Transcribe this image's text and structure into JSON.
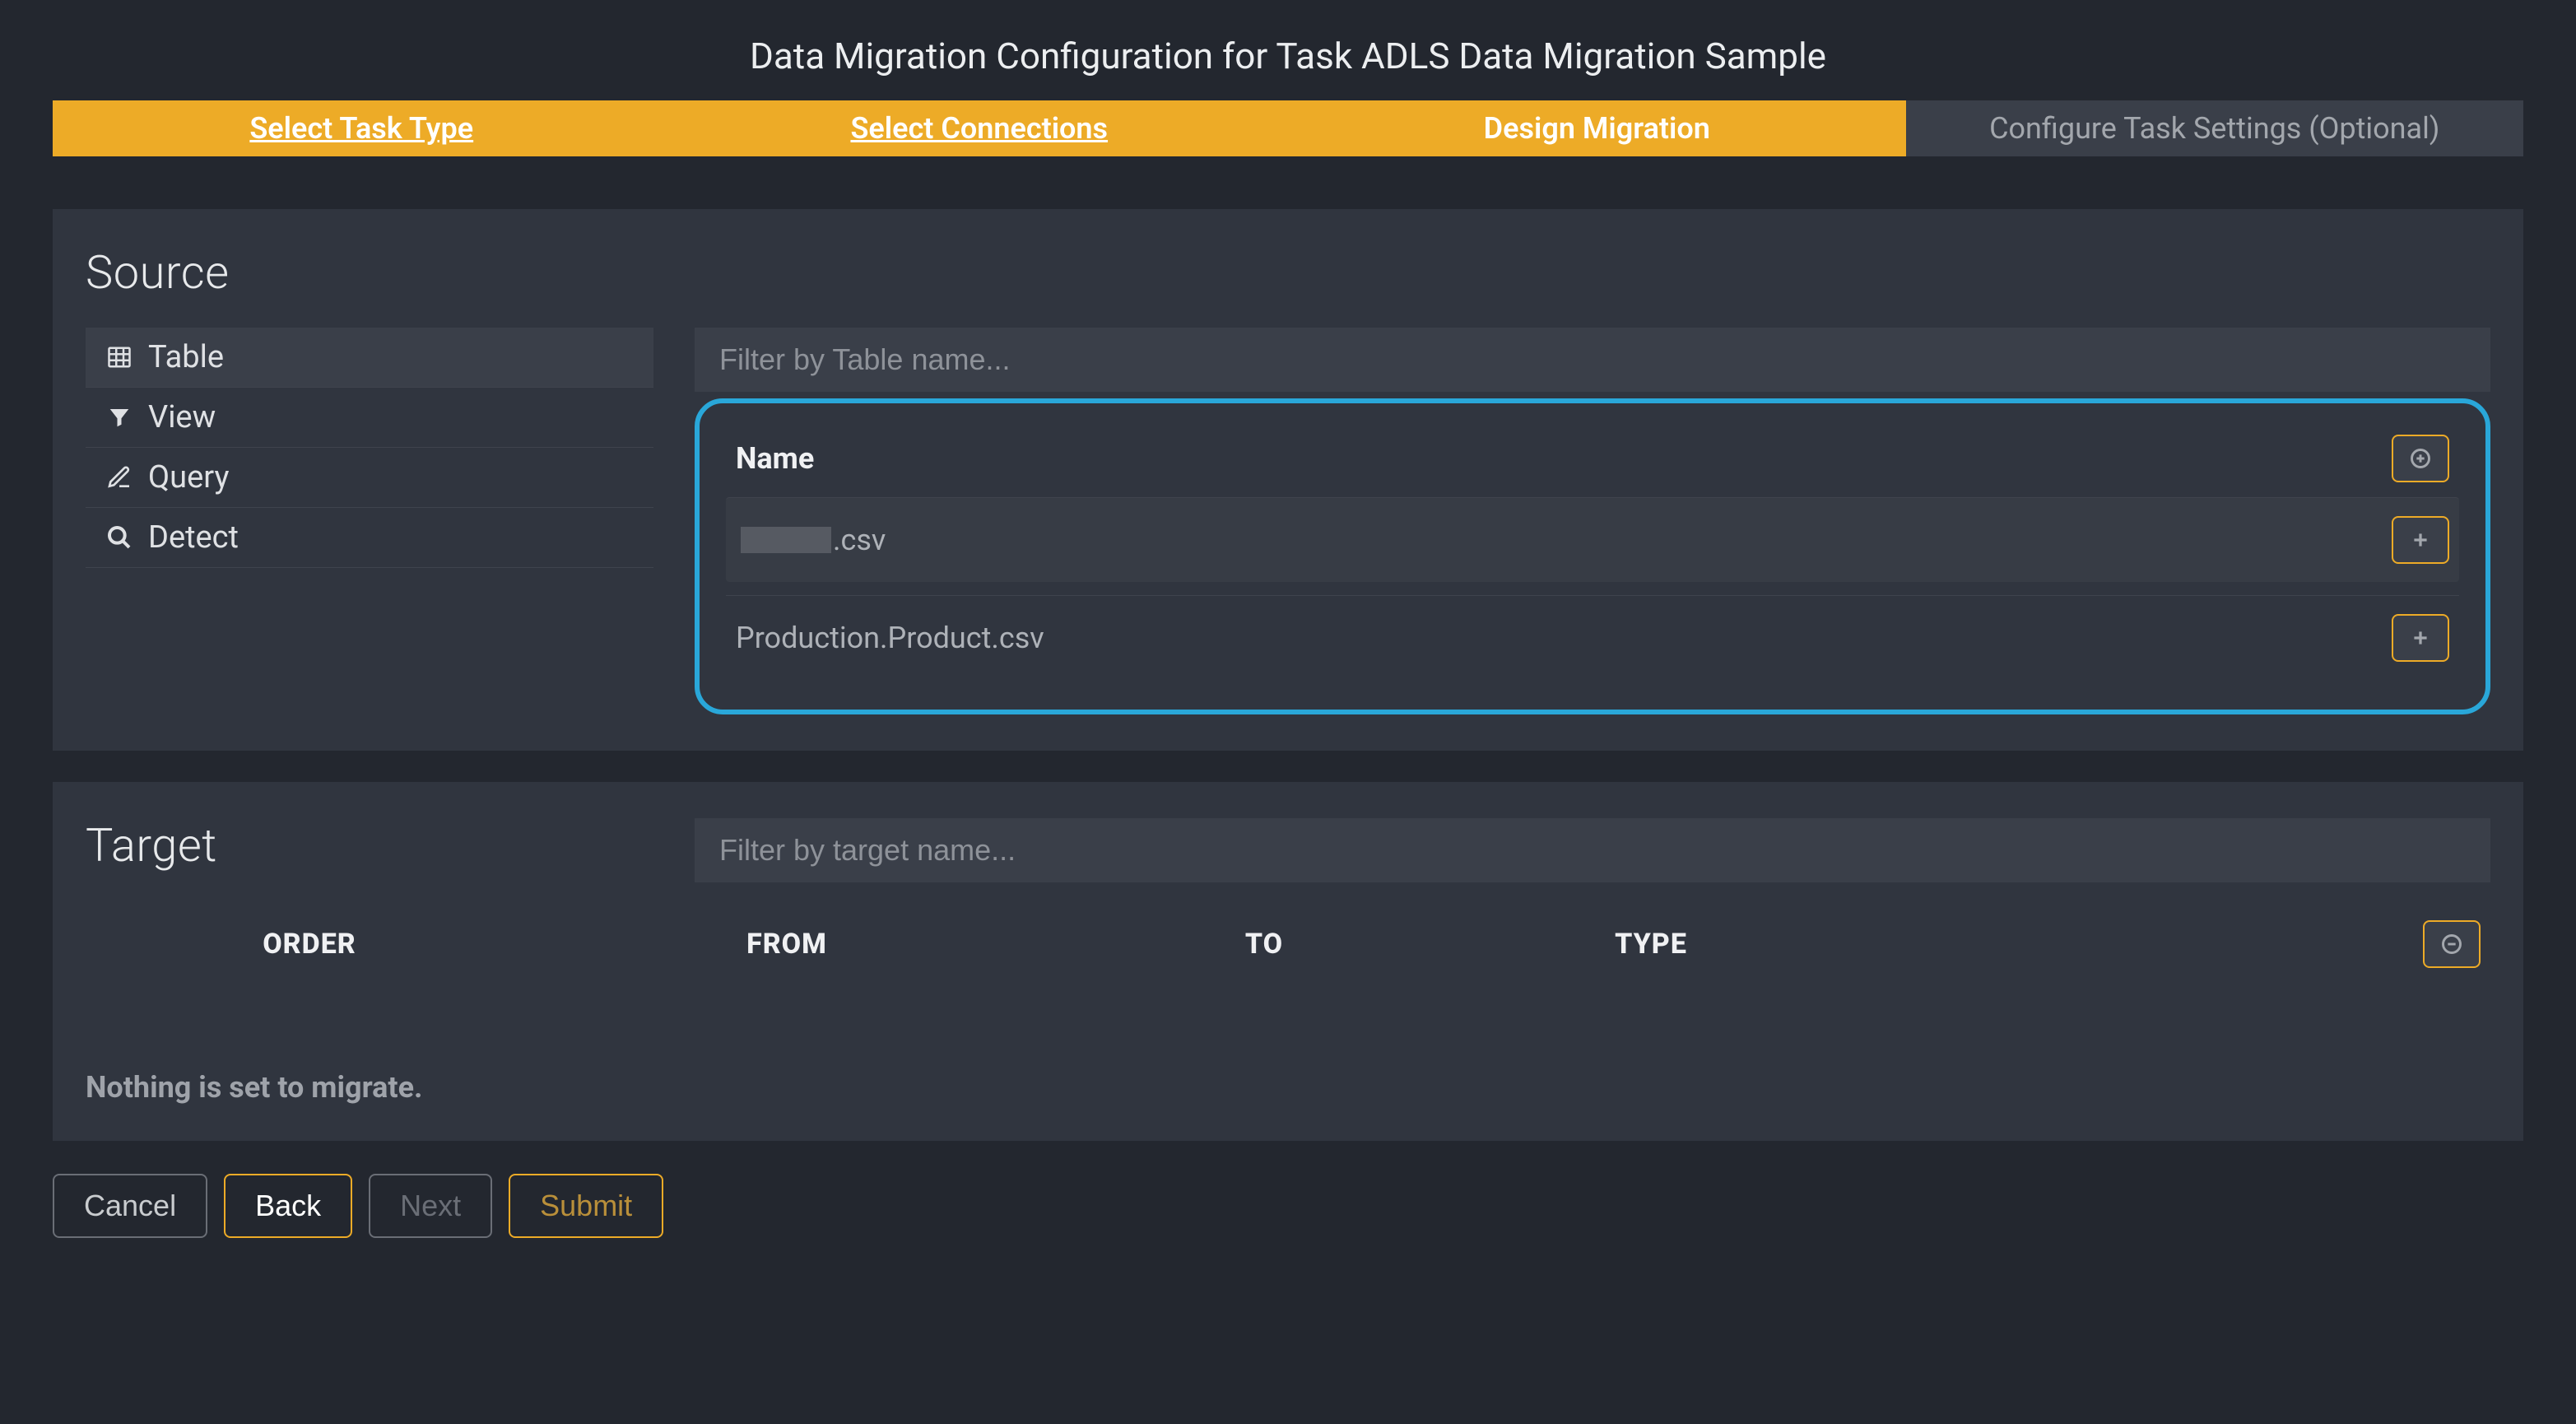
{
  "title": "Data Migration Configuration for Task ADLS Data Migration Sample",
  "steps": [
    {
      "label": "Select Task Type",
      "state": "link"
    },
    {
      "label": "Select Connections",
      "state": "link"
    },
    {
      "label": "Design Migration",
      "state": "active"
    },
    {
      "label": "Configure Task Settings (Optional)",
      "state": "disabled"
    }
  ],
  "source": {
    "heading": "Source",
    "tabs": [
      {
        "label": "Table",
        "icon": "table-icon",
        "active": true
      },
      {
        "label": "View",
        "icon": "filter-icon",
        "active": false
      },
      {
        "label": "Query",
        "icon": "edit-icon",
        "active": false
      },
      {
        "label": "Detect",
        "icon": "search-icon",
        "active": false
      }
    ],
    "filter_placeholder": "Filter by Table name...",
    "name_header": "Name",
    "rows": [
      {
        "redacted_prefix": true,
        "suffix": ".csv"
      },
      {
        "redacted_prefix": false,
        "suffix": "Production.Product.csv"
      }
    ]
  },
  "target": {
    "heading": "Target",
    "filter_placeholder": "Filter by target name...",
    "columns": {
      "order": "ORDER",
      "from": "FROM",
      "to": "TO",
      "type": "TYPE"
    },
    "empty_message": "Nothing is set to migrate."
  },
  "footer": {
    "cancel": "Cancel",
    "back": "Back",
    "next": "Next",
    "submit": "Submit"
  }
}
